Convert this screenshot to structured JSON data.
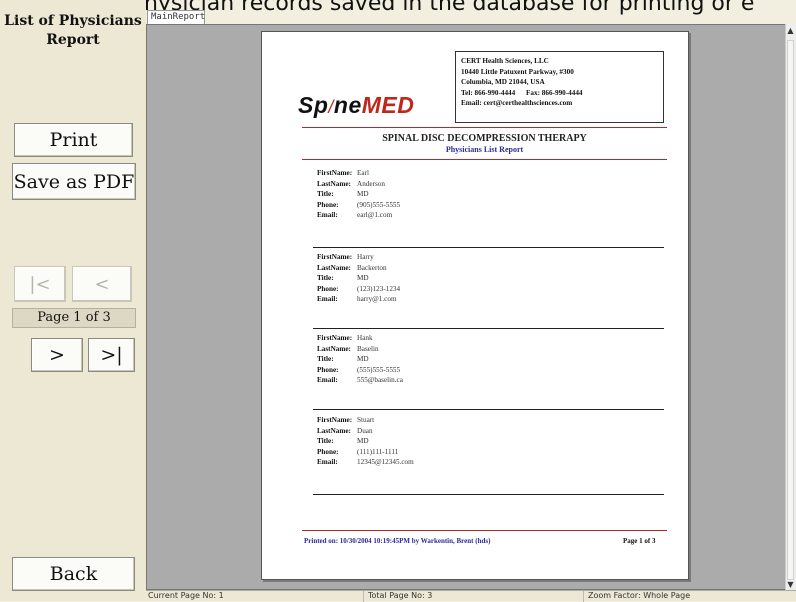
{
  "top_text": "physician records saved in the database for printing or e",
  "sidebar": {
    "title": "List of Physicians Report",
    "print_label": "Print",
    "save_pdf_label": "Save as PDF",
    "first_label": "|<",
    "prev_label": "<",
    "page_indicator": "Page 1 of 3",
    "next_label": ">",
    "last_label": ">|",
    "back_label": "Back"
  },
  "viewer": {
    "tab_label": "MainReport"
  },
  "report": {
    "logo_left": "Sp",
    "logo_slash": "/",
    "logo_mid": "ne",
    "logo_med": "MED",
    "company": {
      "name": "CERT Health Sciences, LLC",
      "address1": "10440 Little Patuxent Parkway, #300",
      "address2": "Columbia, MD 21044, USA",
      "tel": "Tel: 866-990-4444",
      "fax": "Fax: 866-990-4444",
      "email": "Email: cert@certhealthsciences.com"
    },
    "title": "SPINAL DISC DECOMPRESSION THERAPY",
    "subtitle": "Physicians List Report",
    "labels": {
      "first": "FirstName:",
      "last": "LastName:",
      "title": "Title:",
      "phone": "Phone:",
      "email": "Email:"
    },
    "records": [
      {
        "first": "Earl",
        "last": "Anderson",
        "title": "MD",
        "phone": "(905)555-5555",
        "email": "earl@1.com"
      },
      {
        "first": "Harry",
        "last": "Backerton",
        "title": "MD",
        "phone": "(123)123-1234",
        "email": "harry@1.com"
      },
      {
        "first": "Hank",
        "last": "Baselin",
        "title": "MD",
        "phone": "(555)555-5555",
        "email": "555@baselin.ca"
      },
      {
        "first": "Stuart",
        "last": "Duan",
        "title": "MD",
        "phone": "(111)111-1111",
        "email": "12345@12345.com"
      }
    ],
    "footer_left": "Printed on: 10/30/2004 10:19:45PM  by Warkentin, Brent (hds)",
    "footer_right": "Page 1 of 3"
  },
  "statusbar": {
    "current_page": "Current Page No: 1",
    "total_pages": "Total Page No: 3",
    "zoom": "Zoom Factor: Whole Page"
  }
}
